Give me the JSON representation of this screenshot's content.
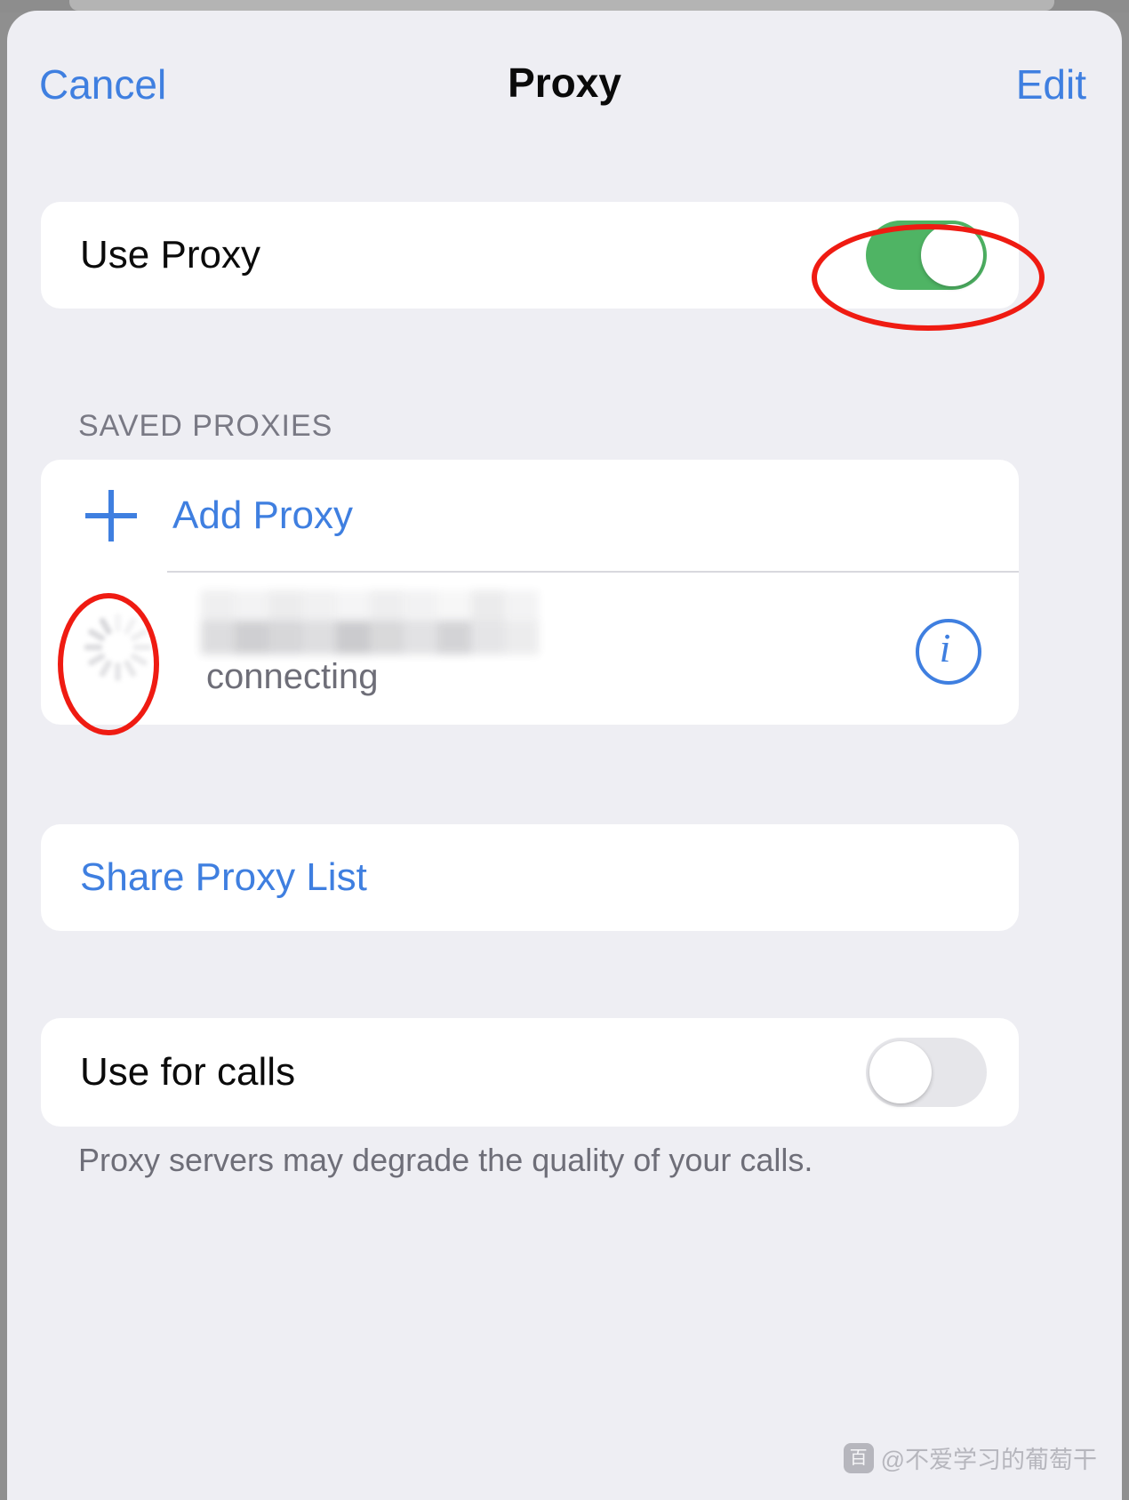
{
  "navbar": {
    "cancel_label": "Cancel",
    "title": "Proxy",
    "edit_label": "Edit"
  },
  "use_proxy": {
    "label": "Use Proxy",
    "toggle_state": "on",
    "toggle_color": "#4fb464"
  },
  "saved_proxies": {
    "section_header": "SAVED PROXIES",
    "add_proxy_label": "Add Proxy",
    "add_proxy_icon": "plus-icon",
    "item": {
      "name": "",
      "name_redacted": true,
      "status": "connecting",
      "icon": "loading-spinner-icon",
      "info_icon": "info-circle-icon",
      "info_glyph": "i"
    }
  },
  "share": {
    "label": "Share Proxy List"
  },
  "calls": {
    "label": "Use for calls",
    "toggle_state": "off",
    "footnote": "Proxy servers may degrade the quality of your calls."
  },
  "annotations": {
    "accent_color": "#ef1b12",
    "toggle_highlight": "red-ellipse-around-use-proxy-toggle",
    "spinner_highlight": "red-ellipse-around-connecting-spinner"
  },
  "watermark": {
    "badge": "百",
    "text": "@不爱学习的葡萄干"
  }
}
